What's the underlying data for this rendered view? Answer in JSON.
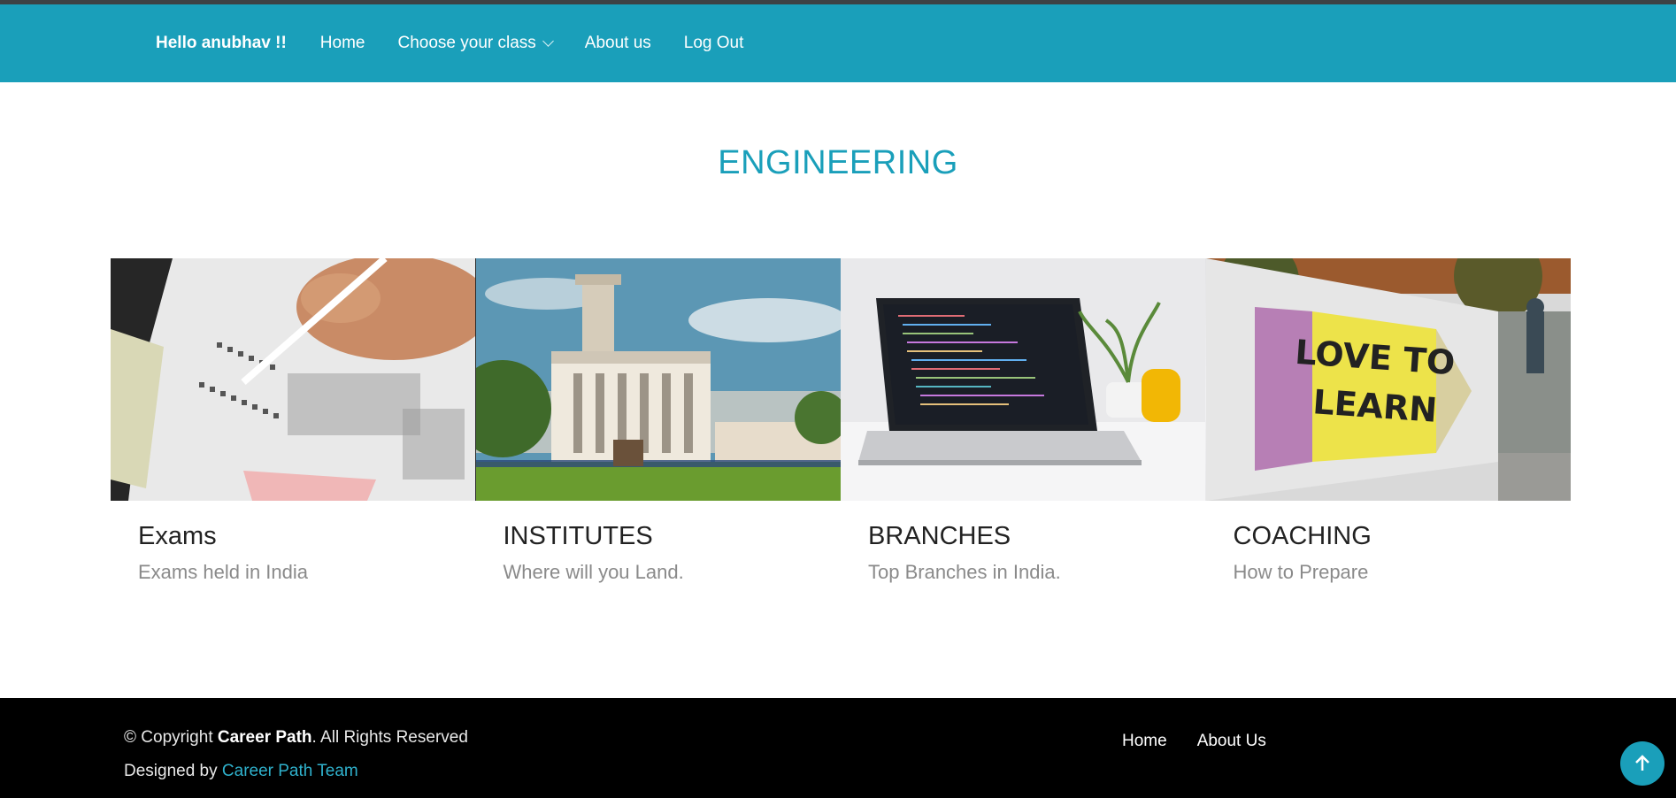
{
  "nav": {
    "greeting": "Hello anubhav !!",
    "home": "Home",
    "choose_class": "Choose your class",
    "about": "About us",
    "logout": "Log Out"
  },
  "page_title": "ENGINEERING",
  "cards": [
    {
      "title": "Exams",
      "subtitle": "Exams held in India"
    },
    {
      "title": "INSTITUTES",
      "subtitle": "Where will you Land."
    },
    {
      "title": "BRANCHES",
      "subtitle": "Top Branches in India."
    },
    {
      "title": "COACHING",
      "subtitle": "How to Prepare"
    }
  ],
  "images": {
    "coaching_sign_line1": "LOVE TO",
    "coaching_sign_line2": "LEARN"
  },
  "footer": {
    "copyright_prefix": "© Copyright ",
    "brand": "Career Path",
    "rights": ". All Rights Reserved",
    "designed_by": "Designed by ",
    "designer": "Career Path Team",
    "links": [
      "Home",
      "About Us"
    ]
  },
  "colors": {
    "primary": "#1a9fba",
    "footer_bg": "#000000"
  },
  "icons": {
    "dropdown": "chevron-down-icon",
    "back_to_top": "arrow-up-icon"
  }
}
